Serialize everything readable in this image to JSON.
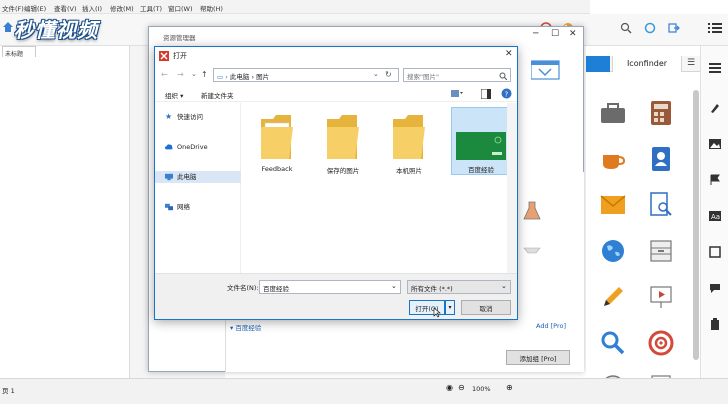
{
  "app": {
    "menu": [
      "文件(F)",
      "编辑(E)",
      "查看(V)",
      "插入(I)",
      "修改(M)",
      "工具(T)",
      "窗口(W)",
      "帮助(H)"
    ],
    "left_tab": "未标题",
    "page_tab": "页 1",
    "zoom": "100%",
    "watermark": "秒懂视频",
    "lower_item": "百度经验",
    "add_pro": "Add [Pro]",
    "add_group_button": "添加组 [Pro]"
  },
  "library": {
    "tab_label": "Iconfinder",
    "menu_glyph": "☰"
  },
  "explorer": {
    "title": "资源管理器"
  },
  "dialog": {
    "title": "打开",
    "breadcrumb": [
      "此电脑",
      "图片"
    ],
    "search_placeholder": "搜索\"图片\"",
    "organize": "组织 ▾",
    "new_folder": "新建文件夹",
    "nav": [
      "快速访问",
      "OneDrive",
      "此电脑",
      "网络"
    ],
    "files": [
      {
        "name": "Feedback"
      },
      {
        "name": "保存的图片"
      },
      {
        "name": "本机照片"
      },
      {
        "name": "百度经验"
      }
    ],
    "filename_label": "文件名(N):",
    "filename_value": "百度经验",
    "filetype_value": "所有文件 (*.*)",
    "open_button": "打开(O)",
    "cancel_button": "取消"
  },
  "colors": {
    "accent": "#1e7fd6",
    "folder": "#f3c95c",
    "selected": "#cce4f7",
    "thumb_green": "#1b8a3e"
  }
}
